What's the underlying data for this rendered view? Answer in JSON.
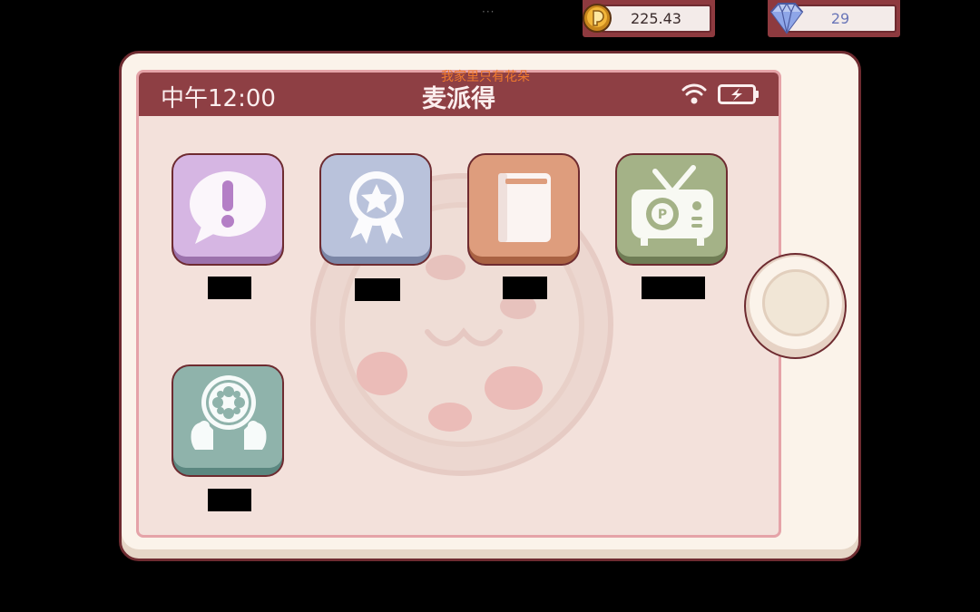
{
  "top_bar": {
    "menu_dots": "···",
    "coins": "225.43",
    "gems": "29"
  },
  "device": {
    "status": {
      "time": "中午12:00",
      "title": "麦派得",
      "icons": [
        "wifi-icon",
        "battery-charging-icon"
      ]
    },
    "notice": "我家里只有花朵",
    "apps": [
      {
        "icon": "message-alert-icon",
        "label": "",
        "color": "#d6b6e3"
      },
      {
        "icon": "award-badge-icon",
        "label": "",
        "color": "#b9c2db"
      },
      {
        "icon": "book-icon",
        "label": "",
        "color": "#de9d7d"
      },
      {
        "icon": "pizza-tv-icon",
        "label": "",
        "color": "#a4b287"
      },
      {
        "icon": "film-reel-icon",
        "label": "",
        "color": "#8fb3ab"
      }
    ]
  },
  "colors": {
    "frame": "#6e2b30",
    "status_bar": "#8e3f44",
    "screen_bg": "#f3e1db",
    "device_bg": "#fbf3ea",
    "notice_text": "#f07a2e"
  }
}
